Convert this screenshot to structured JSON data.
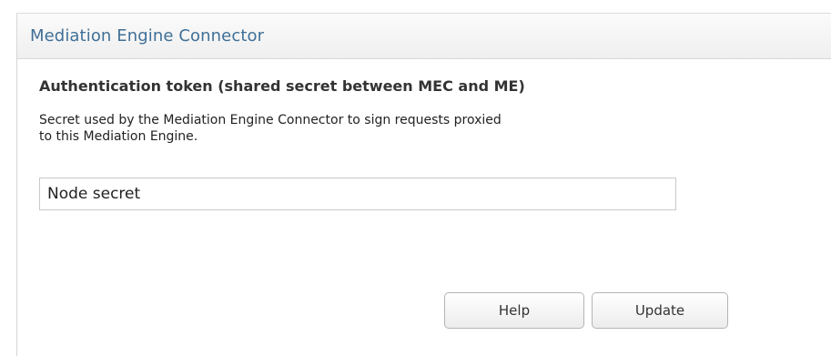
{
  "panel": {
    "title": "Mediation Engine Connector"
  },
  "section": {
    "heading": "Authentication token (shared secret between MEC and ME)",
    "description_line1": "Secret used by the Mediation Engine Connector to sign requests proxied",
    "description_line2": "to this Mediation Engine.",
    "input_value": "Node secret"
  },
  "buttons": {
    "help_label": "Help",
    "update_label": "Update"
  },
  "colors": {
    "title": "#3f6f97",
    "border": "#c9c9c9"
  }
}
